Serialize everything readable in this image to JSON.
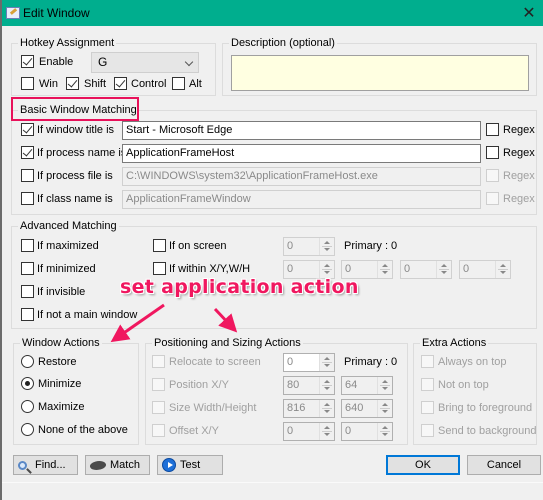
{
  "window": {
    "title": "Edit Window",
    "close_label": "✕",
    "accent_color": "#00ae8e"
  },
  "hotkey": {
    "group_label": "Hotkey Assignment",
    "enable_label": "Enable",
    "enable_checked": true,
    "key_value": "G",
    "modifiers": [
      {
        "label": "Win",
        "checked": false
      },
      {
        "label": "Shift",
        "checked": true
      },
      {
        "label": "Control",
        "checked": true
      },
      {
        "label": "Alt",
        "checked": false
      }
    ]
  },
  "description": {
    "group_label": "Description (optional)",
    "value": ""
  },
  "basic_matching": {
    "group_label": "Basic Window Matching",
    "highlight_color": "#e8115a",
    "rows": [
      {
        "label": "If window title is",
        "checked": true,
        "value": "Start - Microsoft Edge",
        "enabled": true,
        "regex_label": "Regex",
        "regex_checked": false,
        "regex_enabled": true
      },
      {
        "label": "If process name is",
        "checked": true,
        "value": "ApplicationFrameHost",
        "enabled": true,
        "regex_label": "Regex",
        "regex_checked": false,
        "regex_enabled": true
      },
      {
        "label": "If process file is",
        "checked": false,
        "value": "C:\\WINDOWS\\system32\\ApplicationFrameHost.exe",
        "enabled": false,
        "regex_label": "Regex",
        "regex_checked": false,
        "regex_enabled": false
      },
      {
        "label": "If class name is",
        "checked": false,
        "value": "ApplicationFrameWindow",
        "enabled": false,
        "regex_label": "Regex",
        "regex_checked": false,
        "regex_enabled": false
      }
    ]
  },
  "advanced_matching": {
    "group_label": "Advanced Matching",
    "left_options": [
      {
        "label": "If maximized",
        "checked": false
      },
      {
        "label": "If minimized",
        "checked": false
      },
      {
        "label": "If invisible",
        "checked": false
      },
      {
        "label": "If not a main window",
        "checked": false
      }
    ],
    "on_screen": {
      "label": "If on screen",
      "checked": false,
      "value": "0",
      "primary_label": "Primary : 0"
    },
    "within": {
      "label": "If within X/Y,W/H",
      "checked": false,
      "values": [
        "0",
        "0",
        "0",
        "0"
      ]
    }
  },
  "annotation": {
    "text": "set application action",
    "color": "#f0175f"
  },
  "window_actions": {
    "group_label": "Window Actions",
    "options": [
      {
        "label": "Restore",
        "selected": false
      },
      {
        "label": "Minimize",
        "selected": true
      },
      {
        "label": "Maximize",
        "selected": false
      },
      {
        "label": "None of the above",
        "selected": false
      }
    ]
  },
  "positioning": {
    "group_label": "Positioning and Sizing Actions",
    "relocate": {
      "label": "Relocate to screen",
      "checked": false,
      "value": "0",
      "primary_label": "Primary : 0"
    },
    "position": {
      "label": "Position X/Y",
      "checked": false,
      "x": "80",
      "y": "64"
    },
    "size": {
      "label": "Size Width/Height",
      "checked": false,
      "w": "816",
      "h": "640"
    },
    "offset": {
      "label": "Offset X/Y",
      "checked": false,
      "x": "0",
      "y": "0"
    }
  },
  "extra_actions": {
    "group_label": "Extra Actions",
    "options": [
      {
        "label": "Always on top",
        "checked": false
      },
      {
        "label": "Not on top",
        "checked": false
      },
      {
        "label": "Bring to foreground",
        "checked": false
      },
      {
        "label": "Send to background",
        "checked": false
      }
    ]
  },
  "buttons": {
    "find": "Find...",
    "match": "Match",
    "test": "Test",
    "ok": "OK",
    "cancel": "Cancel"
  }
}
